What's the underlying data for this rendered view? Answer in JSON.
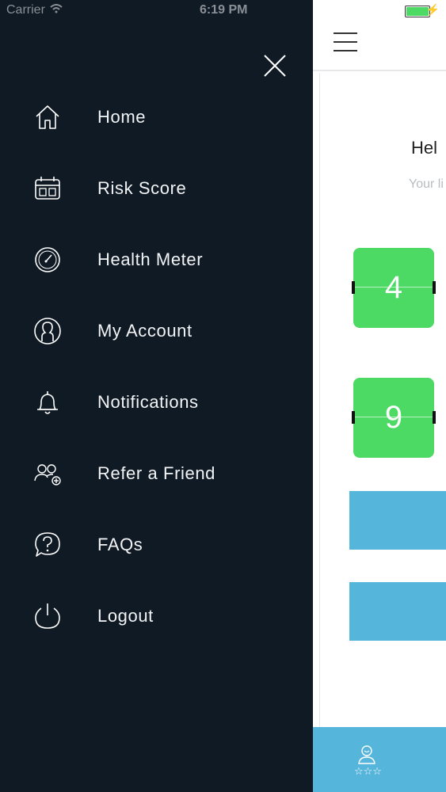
{
  "status": {
    "carrier": "Carrier",
    "time": "6:19 PM",
    "battery_level": 1.0
  },
  "drawer": {
    "items": [
      {
        "label": "Home",
        "icon": "home-icon"
      },
      {
        "label": "Risk Score",
        "icon": "calendar-score-icon"
      },
      {
        "label": "Health Meter",
        "icon": "gauge-icon"
      },
      {
        "label": "My Account",
        "icon": "user-icon"
      },
      {
        "label": "Notifications",
        "icon": "bell-icon"
      },
      {
        "label": "Refer a Friend",
        "icon": "add-users-icon"
      },
      {
        "label": "FAQs",
        "icon": "question-bubble-icon"
      },
      {
        "label": "Logout",
        "icon": "power-icon"
      }
    ]
  },
  "main": {
    "greeting_partial": "Hel",
    "subtitle_partial": "Your li",
    "flip_top": "4",
    "flip_bottom": "9"
  },
  "colors": {
    "drawer_bg": "#101a24",
    "accent_green": "#4cd964",
    "accent_blue": "#56b5da"
  }
}
